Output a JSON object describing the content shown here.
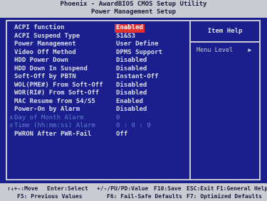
{
  "header": {
    "title_line1": "Phoenix - AwardBIOS CMOS Setup Utility",
    "title_line2": "Power Management Setup"
  },
  "settings": [
    {
      "label": "ACPI function",
      "value": "Enabled",
      "highlight": true
    },
    {
      "label": "ACPI Suspend Type",
      "value": "S1&S3"
    },
    {
      "label": "Power Management",
      "value": "User Define"
    },
    {
      "label": "Video Off Method",
      "value": "DPMS Support"
    },
    {
      "label": "HDD Power Down",
      "value": "Disabled"
    },
    {
      "label": "HDD Down In Suspend",
      "value": "Disabled"
    },
    {
      "label": "Soft-Off by PBTN",
      "value": "Instant-Off"
    },
    {
      "label": "WOL(PME#) From Soft-Off",
      "value": "Disabled"
    },
    {
      "label": "WOR(RI#) From Soft-Off",
      "value": "Disabled"
    },
    {
      "label": "MAC Resume from S4/S5",
      "value": "Enabled"
    },
    {
      "label": "Power-On by Alarm",
      "value": "Disabled"
    },
    {
      "label": "Day of Month Alarm",
      "value": "0",
      "dim": true,
      "marker": "x"
    },
    {
      "label": "Time (hh:mm:ss) Alarm",
      "value": "0 : 0 : 0",
      "dim": true,
      "marker": "x"
    },
    {
      "label": "PWRON After PWR-Fail",
      "value": "Off"
    }
  ],
  "help": {
    "title": "Item Help",
    "menu_level": "Menu Level",
    "menu_arrow": "▶"
  },
  "footer": {
    "line1": [
      "↑↓+-:Move",
      "Enter:Select",
      "+/-/PU/PD:Value",
      "F10:Save",
      "ESC:Exit",
      "F1:General Help"
    ],
    "line2": [
      "F5: Previous Values",
      "F6: Fail-Safe Defaults",
      "F7: Optimized Defaults"
    ]
  },
  "colors": {
    "background": "#1b1f8e",
    "highlight": "#e03030",
    "frame": "#c9cbd3",
    "dim_text": "#5f7fd0"
  }
}
